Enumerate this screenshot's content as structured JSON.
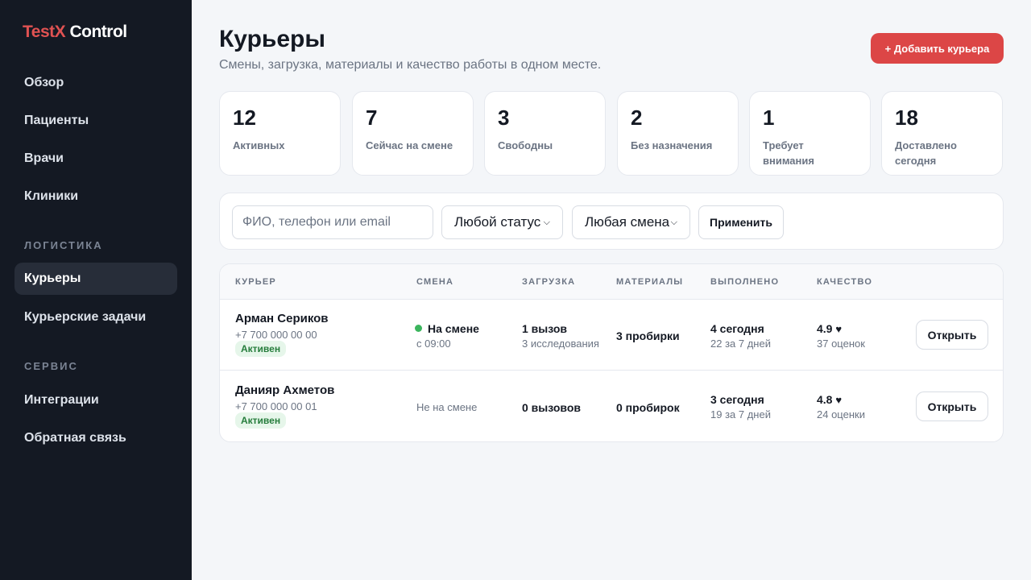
{
  "app": {
    "logo_part1": "TestX",
    "logo_part2": "Control"
  },
  "sidebar": {
    "items_top": [
      "Обзор",
      "Пациенты",
      "Врачи",
      "Клиники"
    ],
    "section_logistics": "ЛОГИСТИКА",
    "items_logistics": [
      "Курьеры",
      "Курьерские задачи"
    ],
    "section_service": "СЕРВИС",
    "items_service": [
      "Интеграции",
      "Обратная связь"
    ],
    "active_item": "Курьеры"
  },
  "header": {
    "title": "Курьеры",
    "subtitle": "Смены, загрузка, материалы и качество работы в одном месте.",
    "add_button": "+ Добавить курьера"
  },
  "stats": [
    {
      "value": "12",
      "label": "Активных"
    },
    {
      "value": "7",
      "label": "Сейчас на смене"
    },
    {
      "value": "3",
      "label": "Свободны"
    },
    {
      "value": "2",
      "label": "Без назначения"
    },
    {
      "value": "1",
      "label": "Требует внимания"
    },
    {
      "value": "18",
      "label": "Доставлено сегодня"
    }
  ],
  "filters": {
    "search_placeholder": "ФИО, телефон или email",
    "status_select": "Любой статус",
    "shift_select": "Любая смена",
    "apply_button": "Применить"
  },
  "table": {
    "columns": [
      "КУРЬЕР",
      "СМЕНА",
      "ЗАГРУЗКА",
      "МАТЕРИАЛЫ",
      "ВЫПОЛНЕНО",
      "КАЧЕСТВО"
    ],
    "rows": [
      {
        "name": "Арман Сериков",
        "phone": "+7 700 000 00 00",
        "status": "Активен",
        "shift": "На смене",
        "shift_since": "с 09:00",
        "load": "1 вызов",
        "load_sub": "3 исследования",
        "materials": "3 пробирки",
        "done": "4 сегодня",
        "done_sub": "22 за 7 дней",
        "rating": "4.9",
        "reviews": "37 оценок",
        "open_button": "Открыть"
      },
      {
        "name": "Данияр Ахметов",
        "phone": "+7 700 000 00 01",
        "status": "Активен",
        "shift": "Не на смене",
        "load": "0 вызовов",
        "materials": "0 пробирок",
        "done": "3 сегодня",
        "done_sub": "19 за 7 дней",
        "rating": "4.8",
        "reviews": "24 оценки",
        "open_button": "Открыть"
      }
    ]
  },
  "colors": {
    "brand_red": "#e05252",
    "sidebar_bg": "#141923",
    "status_green": "#3bb55d"
  }
}
